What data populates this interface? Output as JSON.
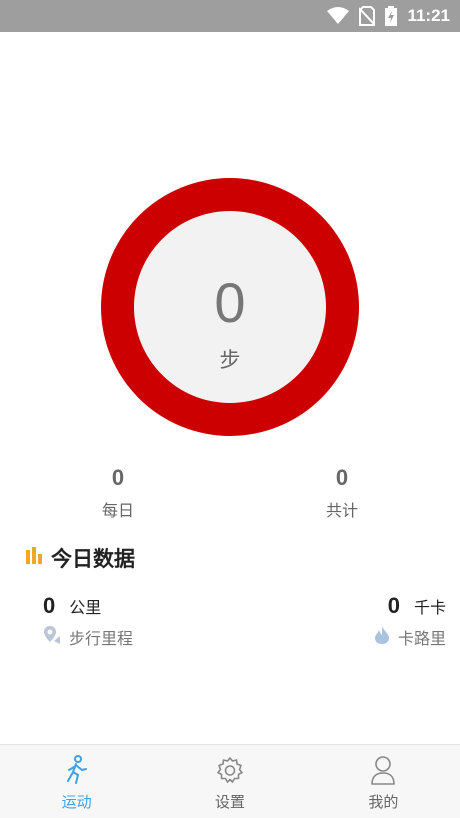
{
  "status_bar": {
    "time": "11:21"
  },
  "steps": {
    "count": "0",
    "unit": "步"
  },
  "stats": {
    "daily": {
      "value": "0",
      "label": "每日"
    },
    "total": {
      "value": "0",
      "label": "共计"
    }
  },
  "today": {
    "title": "今日数据",
    "distance": {
      "value": "0",
      "unit": "公里",
      "label": "步行里程"
    },
    "calories": {
      "value": "0",
      "unit": "千卡",
      "label": "卡路里"
    }
  },
  "tabs": [
    {
      "label": "运动",
      "icon": "walk-icon",
      "active": true
    },
    {
      "label": "设置",
      "icon": "gear-icon",
      "active": false
    },
    {
      "label": "我的",
      "icon": "user-icon",
      "active": false
    }
  ],
  "colors": {
    "ring": "#cc0000",
    "accent": "#3aa3e3",
    "chart_icon": "#f5a623"
  }
}
